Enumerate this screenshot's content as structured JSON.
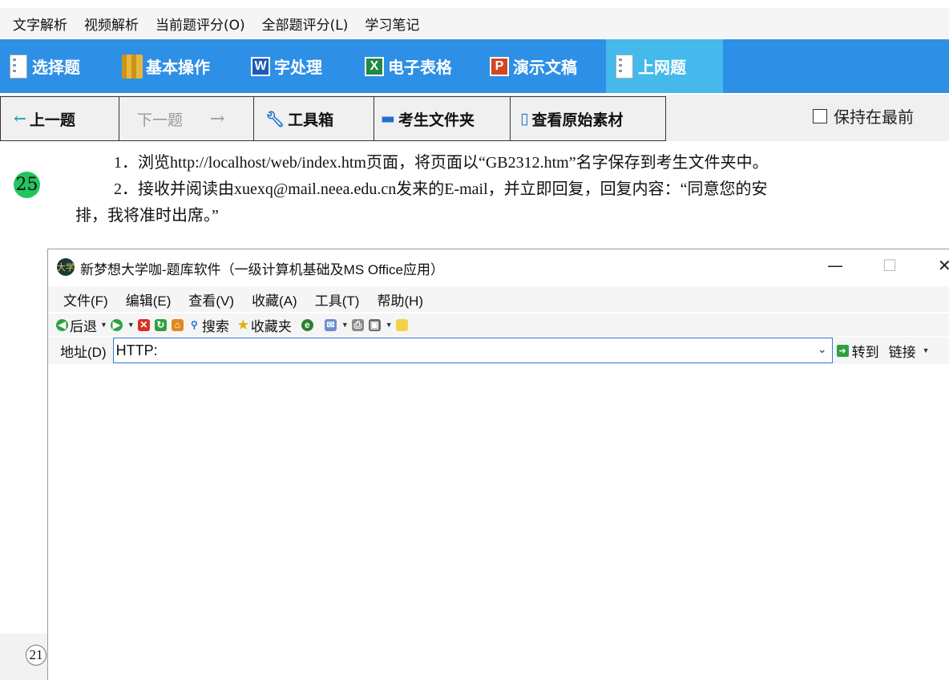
{
  "top_menu": [
    "文字解析",
    "视频解析",
    "当前题评分(O)",
    "全部题评分(L)",
    "学习笔记"
  ],
  "category_tabs": [
    {
      "label": "选择题",
      "icon": "document-icon"
    },
    {
      "label": "基本操作",
      "icon": "folder-icon"
    },
    {
      "label": "字处理",
      "icon": "word-icon",
      "glyph": "W"
    },
    {
      "label": "电子表格",
      "icon": "excel-icon",
      "glyph": "X"
    },
    {
      "label": "演示文稿",
      "icon": "powerpoint-icon",
      "glyph": "P"
    },
    {
      "label": "上网题",
      "icon": "document-icon",
      "active": true
    }
  ],
  "nav": {
    "prev": "上一题",
    "next": "下一题",
    "toolbox": "工具箱",
    "student_folder": "考生文件夹",
    "view_material": "查看原始素材",
    "keep_on_top": "保持在最前",
    "keep_on_top_checked": false
  },
  "question": {
    "number": "25",
    "line1": "1．浏览http://localhost/web/index.htm页面，将页面以“GB2312.htm”名字保存到考生文件夹中。",
    "line2": "2．接收并阅读由xuexq@mail.neea.edu.cn发来的E-mail，并立即回复，回复内容：“同意您的安",
    "line3": "排，我将准时出席。”"
  },
  "side_number": "21",
  "browser": {
    "title": "新梦想大学咖-题库软件（一级计算机基础及MS Office应用）",
    "logo_text": "大学",
    "minimize": "—",
    "maximize": "☐",
    "close": "✕",
    "menu": [
      "文件(F)",
      "编辑(E)",
      "查看(V)",
      "收藏(A)",
      "工具(T)",
      "帮助(H)"
    ],
    "toolbar": {
      "back": "后退",
      "search": "搜索",
      "favorites": "收藏夹"
    },
    "address_label": "地址(D)",
    "address_value": "HTTP:",
    "goto_label": "转到",
    "links_label": "链接"
  },
  "colors": {
    "tab_bar": "#2e8fe6",
    "tab_active": "#45b9ec",
    "question_badge": "#22c55e"
  }
}
